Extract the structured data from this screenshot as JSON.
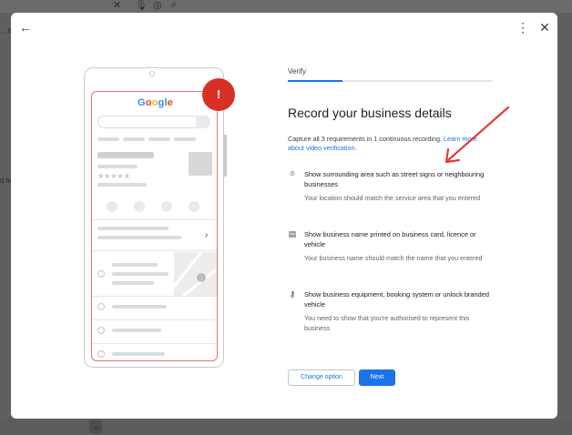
{
  "background": {
    "top_icons": [
      "close-icon",
      "microphone-icon",
      "lens-icon",
      "search-icon"
    ],
    "side_text_1": "... M",
    "side_text_2": "d le"
  },
  "dialog": {
    "back_icon": "arrow-left-icon",
    "more_icon": "more-vert-icon",
    "close_icon": "close-icon"
  },
  "illustration": {
    "logo_letters": [
      "G",
      "o",
      "o",
      "g",
      "l",
      "e"
    ],
    "logo_colors": [
      "#4285f4",
      "#ea4335",
      "#fbbc05",
      "#4285f4",
      "#34a853",
      "#ea4335"
    ],
    "stars": "★★★★★",
    "badge": "!",
    "accent_color": "#d93025",
    "frame_color": "#e57373"
  },
  "step": {
    "label": "Verify",
    "progress": 0.27
  },
  "title": "Record your business details",
  "intro": {
    "text": "Capture all 3 requirements in 1 continuous recording. ",
    "link": "Learn more about video verification."
  },
  "requirements": [
    {
      "icon": "location-pin-icon",
      "glyph": "⌾",
      "title": "Show surrounding area such as street signs or neighbouring businesses",
      "description": "Your location should match the service area that you entered"
    },
    {
      "icon": "storefront-icon",
      "glyph": "▤",
      "title": "Show business name printed on business card, licence or vehicle",
      "description": "Your business name should match the name that you entered"
    },
    {
      "icon": "key-icon",
      "glyph": "⚷",
      "title": "Show business equipment, booking system or unlock branded vehicle",
      "description": "You need to show that you're authorised to represent this business"
    }
  ],
  "buttons": {
    "change": "Change option",
    "next": "Next"
  },
  "colors": {
    "primary": "#1a73e8",
    "annotation": "#e53935"
  }
}
